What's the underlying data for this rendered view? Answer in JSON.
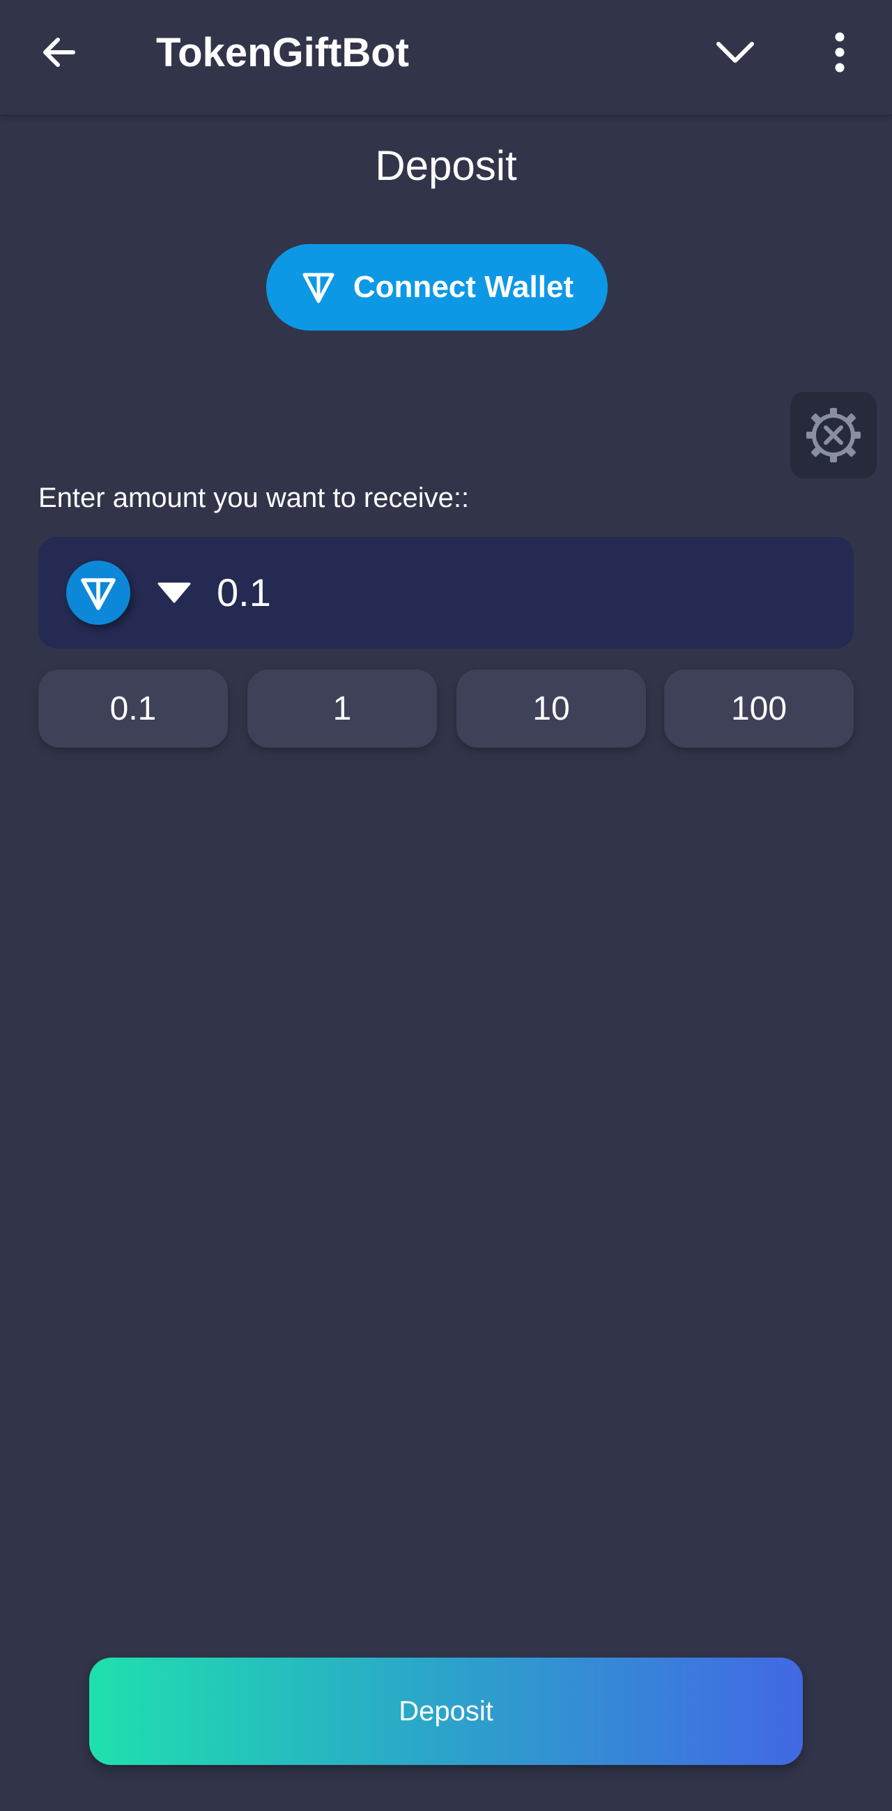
{
  "header": {
    "title": "TokenGiftBot",
    "back_icon": "arrow-left-icon",
    "collapse_icon": "chevron-down-icon",
    "menu_icon": "more-vertical-icon"
  },
  "page": {
    "title": "Deposit"
  },
  "wallet": {
    "connect_label": "Connect Wallet",
    "icon": "ton-logo-icon"
  },
  "settings": {
    "icon": "gear-tools-icon"
  },
  "amount": {
    "label": "Enter amount you want to receive::",
    "value": "0.1",
    "token_icon": "ton-logo-icon",
    "caret_icon": "caret-down-icon"
  },
  "presets": [
    "0.1",
    "1",
    "10",
    "100"
  ],
  "footer": {
    "deposit_label": "Deposit"
  },
  "colors": {
    "background": "#32354a",
    "accent_blue": "#0d98e6",
    "input_bg": "#242a51",
    "preset_bg": "#3e4157",
    "gradient_start": "#1fe0ad",
    "gradient_end": "#4268e4"
  }
}
